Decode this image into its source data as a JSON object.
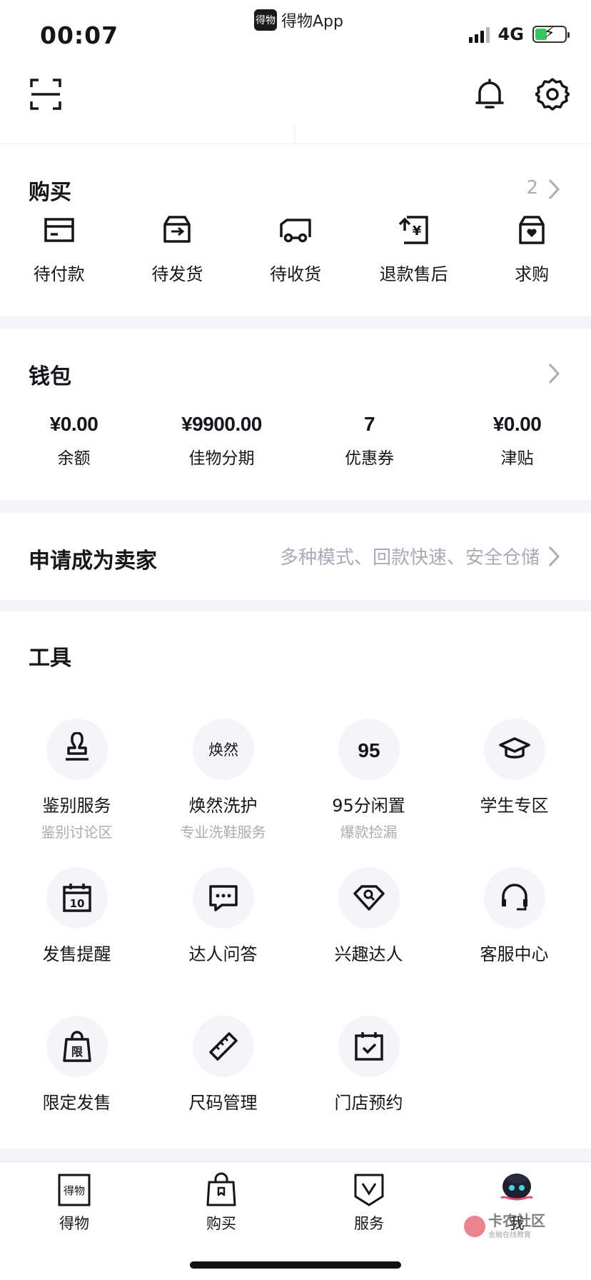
{
  "status_bar": {
    "time": "00:07",
    "back_app": "得物App",
    "back_app_logo": "得物",
    "network": "4G"
  },
  "header": {
    "scan_icon": "scan-icon",
    "bell_icon": "bell-icon",
    "settings_icon": "gear-icon"
  },
  "buy": {
    "title": "购买",
    "count": "2",
    "items": [
      {
        "label": "待付款",
        "icon": "card-icon"
      },
      {
        "label": "待发货",
        "icon": "box-icon"
      },
      {
        "label": "待收货",
        "icon": "truck-icon"
      },
      {
        "label": "退款售后",
        "icon": "refund-icon"
      },
      {
        "label": "求购",
        "icon": "wish-box-icon"
      }
    ]
  },
  "wallet": {
    "title": "钱包",
    "items": [
      {
        "value": "¥0.00",
        "label": "余额"
      },
      {
        "value": "¥9900.00",
        "label": "佳物分期"
      },
      {
        "value": "7",
        "label": "优惠券"
      },
      {
        "value": "¥0.00",
        "label": "津贴"
      }
    ]
  },
  "seller": {
    "title": "申请成为卖家",
    "subtitle": "多种模式、回款快速、安全仓储"
  },
  "tools": {
    "title": "工具",
    "items": [
      {
        "name": "鉴别服务",
        "sub": "鉴别讨论区",
        "icon": "stamp-icon"
      },
      {
        "name": "焕然洗护",
        "sub": "专业洗鞋服务",
        "icon": "huanran-logo-icon",
        "glyph": "焕然"
      },
      {
        "name": "95分闲置",
        "sub": "爆款捡漏",
        "icon": "95-logo-icon",
        "glyph": "95"
      },
      {
        "name": "学生专区",
        "sub": "",
        "icon": "graduation-cap-icon"
      },
      {
        "name": "发售提醒",
        "sub": "",
        "icon": "calendar-icon",
        "glyph": "10"
      },
      {
        "name": "达人问答",
        "sub": "",
        "icon": "chat-bubble-icon"
      },
      {
        "name": "兴趣达人",
        "sub": "",
        "icon": "diamond-search-icon"
      },
      {
        "name": "客服中心",
        "sub": "",
        "icon": "headset-icon"
      },
      {
        "name": "限定发售",
        "sub": "",
        "icon": "limited-bag-icon",
        "glyph": "限"
      },
      {
        "name": "尺码管理",
        "sub": "",
        "icon": "ruler-icon"
      },
      {
        "name": "门店预约",
        "sub": "",
        "icon": "calendar-check-icon"
      }
    ]
  },
  "tabbar": {
    "items": [
      {
        "label": "得物",
        "icon": "dewu-logo-icon",
        "glyph": "得物"
      },
      {
        "label": "购买",
        "icon": "shopping-bag-icon"
      },
      {
        "label": "服务",
        "icon": "shield-v-icon"
      },
      {
        "label": "我",
        "icon": "avatar-icon"
      }
    ]
  },
  "watermark": {
    "name": "卡农社区",
    "sub": "金融在线教育"
  }
}
